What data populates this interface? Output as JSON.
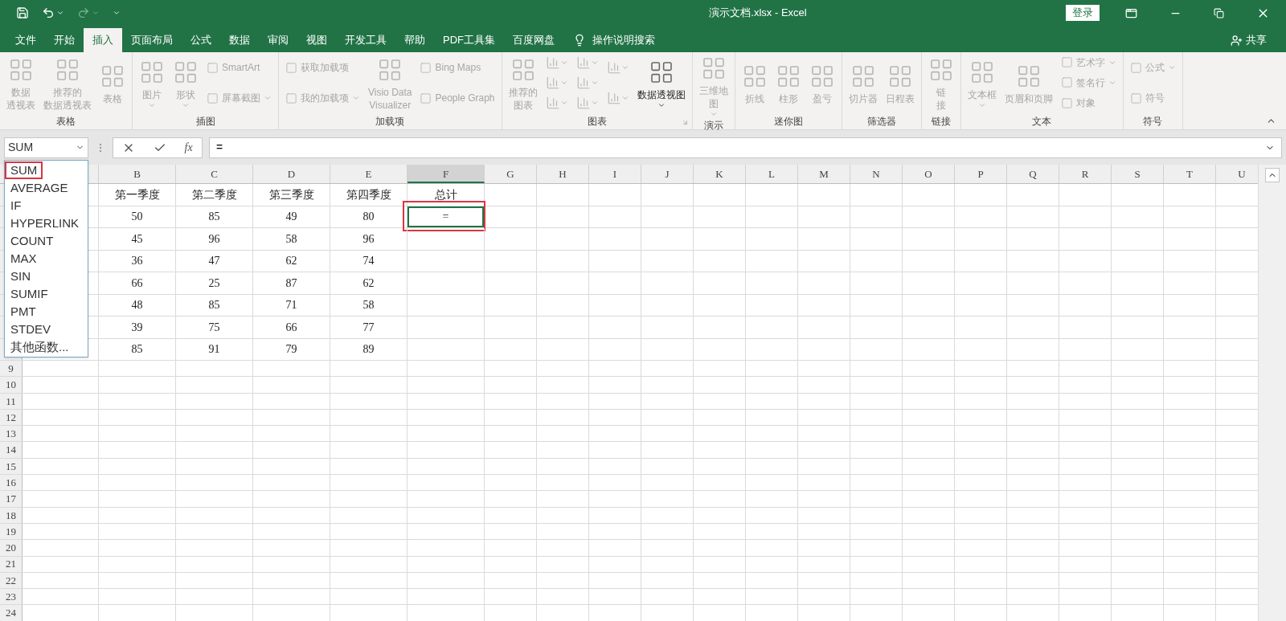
{
  "window": {
    "title": "演示文档.xlsx - Excel",
    "login": "登录"
  },
  "menu_tabs": [
    {
      "label": "文件",
      "selected": false
    },
    {
      "label": "开始",
      "selected": false
    },
    {
      "label": "插入",
      "selected": true
    },
    {
      "label": "页面布局",
      "selected": false
    },
    {
      "label": "公式",
      "selected": false
    },
    {
      "label": "数据",
      "selected": false
    },
    {
      "label": "审阅",
      "selected": false
    },
    {
      "label": "视图",
      "selected": false
    },
    {
      "label": "开发工具",
      "selected": false
    },
    {
      "label": "帮助",
      "selected": false
    },
    {
      "label": "PDF工具集",
      "selected": false
    },
    {
      "label": "百度网盘",
      "selected": false
    }
  ],
  "tell_me": "操作说明搜索",
  "share": "共享",
  "ribbon": [
    {
      "label": "表格",
      "columns": [
        [
          {
            "kind": "large",
            "lines": [
              "数据",
              "透视表"
            ],
            "disabled": true,
            "dropdown": false
          }
        ],
        [
          {
            "kind": "large",
            "lines": [
              "推荐的",
              "数据透视表"
            ],
            "disabled": true,
            "dropdown": false
          }
        ],
        [
          {
            "kind": "large",
            "lines": [
              "表格"
            ],
            "disabled": true,
            "dropdown": false
          }
        ]
      ]
    },
    {
      "label": "插图",
      "columns": [
        [
          {
            "kind": "large",
            "lines": [
              "图片"
            ],
            "disabled": true,
            "dropdown": true
          }
        ],
        [
          {
            "kind": "large",
            "lines": [
              "形状"
            ],
            "disabled": true,
            "dropdown": true
          }
        ],
        [
          {
            "kind": "small",
            "label": "SmartArt",
            "disabled": true,
            "dropdown": false
          },
          {
            "kind": "small",
            "label": "屏幕截图",
            "disabled": true,
            "dropdown": true
          }
        ]
      ]
    },
    {
      "label": "加载项",
      "columns": [
        [
          {
            "kind": "small",
            "label": "获取加载项",
            "disabled": true,
            "dropdown": false
          },
          {
            "kind": "small",
            "label": "我的加载项",
            "disabled": true,
            "dropdown": true
          }
        ],
        [
          {
            "kind": "large",
            "lines": [
              "Visio Data",
              "Visualizer"
            ],
            "disabled": true,
            "dropdown": false
          }
        ],
        [
          {
            "kind": "small",
            "label": "Bing Maps",
            "disabled": true,
            "dropdown": false
          },
          {
            "kind": "small",
            "label": "People Graph",
            "disabled": true,
            "dropdown": false
          }
        ]
      ]
    },
    {
      "label": "图表",
      "launcher": true,
      "columns": [
        [
          {
            "kind": "large",
            "lines": [
              "推荐的",
              "图表"
            ],
            "disabled": true,
            "dropdown": false
          }
        ],
        [
          {
            "kind": "icon",
            "disabled": true,
            "dropdown": true
          },
          {
            "kind": "icon",
            "disabled": true,
            "dropdown": true
          },
          {
            "kind": "icon",
            "disabled": true,
            "dropdown": true
          }
        ],
        [
          {
            "kind": "icon",
            "disabled": true,
            "dropdown": true
          },
          {
            "kind": "icon",
            "disabled": true,
            "dropdown": true
          },
          {
            "kind": "icon",
            "disabled": true,
            "dropdown": true
          }
        ],
        [
          {
            "kind": "icon",
            "disabled": true,
            "dropdown": true
          },
          {
            "kind": "icon",
            "disabled": true,
            "dropdown": true
          }
        ],
        [
          {
            "kind": "large",
            "lines": [
              "数据透视图"
            ],
            "disabled": false,
            "dropdown": true
          }
        ]
      ]
    },
    {
      "label": "演示",
      "columns": [
        [
          {
            "kind": "large",
            "lines": [
              "三维地",
              "图"
            ],
            "disabled": true,
            "dropdown": true
          }
        ]
      ]
    },
    {
      "label": "迷你图",
      "columns": [
        [
          {
            "kind": "large",
            "lines": [
              "折线"
            ],
            "disabled": true,
            "dropdown": false
          }
        ],
        [
          {
            "kind": "large",
            "lines": [
              "柱形"
            ],
            "disabled": true,
            "dropdown": false
          }
        ],
        [
          {
            "kind": "large",
            "lines": [
              "盈亏"
            ],
            "disabled": true,
            "dropdown": false
          }
        ]
      ]
    },
    {
      "label": "筛选器",
      "columns": [
        [
          {
            "kind": "large",
            "lines": [
              "切片器"
            ],
            "disabled": true,
            "dropdown": false
          }
        ],
        [
          {
            "kind": "large",
            "lines": [
              "日程表"
            ],
            "disabled": true,
            "dropdown": false
          }
        ]
      ]
    },
    {
      "label": "链接",
      "columns": [
        [
          {
            "kind": "large",
            "lines": [
              "链",
              "接"
            ],
            "disabled": true,
            "dropdown": false
          }
        ]
      ]
    },
    {
      "label": "文本",
      "columns": [
        [
          {
            "kind": "large",
            "lines": [
              "文本框"
            ],
            "disabled": true,
            "dropdown": true
          }
        ],
        [
          {
            "kind": "large",
            "lines": [
              "页眉和页脚"
            ],
            "disabled": true,
            "dropdown": false
          }
        ],
        [
          {
            "kind": "small",
            "label": "艺术字",
            "disabled": true,
            "dropdown": true
          },
          {
            "kind": "small",
            "label": "签名行",
            "disabled": true,
            "dropdown": true
          },
          {
            "kind": "small",
            "label": "对象",
            "disabled": true,
            "dropdown": false
          }
        ]
      ]
    },
    {
      "label": "符号",
      "columns": [
        [
          {
            "kind": "small",
            "label": "公式",
            "disabled": true,
            "dropdown": true
          },
          {
            "kind": "small",
            "label": "符号",
            "disabled": true,
            "dropdown": false
          }
        ]
      ]
    }
  ],
  "formula_bar": {
    "name_box": "SUM",
    "function_button": "fx",
    "formula": "="
  },
  "function_list": [
    {
      "label": "SUM",
      "highlighted": true
    },
    {
      "label": "AVERAGE",
      "highlighted": false
    },
    {
      "label": "IF",
      "highlighted": false
    },
    {
      "label": "HYPERLINK",
      "highlighted": false
    },
    {
      "label": "COUNT",
      "highlighted": false
    },
    {
      "label": "MAX",
      "highlighted": false
    },
    {
      "label": "SIN",
      "highlighted": false
    },
    {
      "label": "SUMIF",
      "highlighted": false
    },
    {
      "label": "PMT",
      "highlighted": false
    },
    {
      "label": "STDEV",
      "highlighted": false
    },
    {
      "label": "其他函数...",
      "highlighted": false
    }
  ],
  "columns": [
    {
      "label": "B",
      "selected": false
    },
    {
      "label": "C",
      "selected": false
    },
    {
      "label": "D",
      "selected": false
    },
    {
      "label": "E",
      "selected": false
    },
    {
      "label": "F",
      "selected": true
    },
    {
      "label": "G",
      "selected": false
    },
    {
      "label": "H",
      "selected": false
    },
    {
      "label": "I",
      "selected": false
    },
    {
      "label": "J",
      "selected": false
    },
    {
      "label": "K",
      "selected": false
    },
    {
      "label": "L",
      "selected": false
    },
    {
      "label": "M",
      "selected": false
    },
    {
      "label": "N",
      "selected": false
    },
    {
      "label": "O",
      "selected": false
    },
    {
      "label": "P",
      "selected": false
    },
    {
      "label": "Q",
      "selected": false
    },
    {
      "label": "R",
      "selected": false
    },
    {
      "label": "S",
      "selected": false
    },
    {
      "label": "T",
      "selected": false
    },
    {
      "label": "U",
      "selected": false
    }
  ],
  "rows": [
    {
      "cells": [
        {
          "text": "第一季度",
          "selected": false,
          "highlighted": false
        },
        {
          "text": "第二季度",
          "selected": false,
          "highlighted": false
        },
        {
          "text": "第三季度",
          "selected": false,
          "highlighted": false
        },
        {
          "text": "第四季度",
          "selected": false,
          "highlighted": false
        },
        {
          "text": "总计",
          "selected": false,
          "highlighted": false
        }
      ]
    },
    {
      "cells": [
        {
          "text": "50",
          "selected": false,
          "highlighted": false
        },
        {
          "text": "85",
          "selected": false,
          "highlighted": false
        },
        {
          "text": "49",
          "selected": false,
          "highlighted": false
        },
        {
          "text": "80",
          "selected": false,
          "highlighted": false
        },
        {
          "text": "=",
          "selected": true,
          "highlighted": true
        }
      ]
    },
    {
      "cells": [
        {
          "text": "45",
          "selected": false,
          "highlighted": false
        },
        {
          "text": "96",
          "selected": false,
          "highlighted": false
        },
        {
          "text": "58",
          "selected": false,
          "highlighted": false
        },
        {
          "text": "96",
          "selected": false,
          "highlighted": false
        }
      ]
    },
    {
      "cells": [
        {
          "text": "36",
          "selected": false,
          "highlighted": false
        },
        {
          "text": "47",
          "selected": false,
          "highlighted": false
        },
        {
          "text": "62",
          "selected": false,
          "highlighted": false
        },
        {
          "text": "74",
          "selected": false,
          "highlighted": false
        }
      ]
    },
    {
      "cells": [
        {
          "text": "66",
          "selected": false,
          "highlighted": false
        },
        {
          "text": "25",
          "selected": false,
          "highlighted": false
        },
        {
          "text": "87",
          "selected": false,
          "highlighted": false
        },
        {
          "text": "62",
          "selected": false,
          "highlighted": false
        }
      ]
    },
    {
      "cells": [
        {
          "text": "48",
          "selected": false,
          "highlighted": false
        },
        {
          "text": "85",
          "selected": false,
          "highlighted": false
        },
        {
          "text": "71",
          "selected": false,
          "highlighted": false
        },
        {
          "text": "58",
          "selected": false,
          "highlighted": false
        }
      ]
    },
    {
      "cells": [
        {
          "text": "39",
          "selected": false,
          "highlighted": false
        },
        {
          "text": "75",
          "selected": false,
          "highlighted": false
        },
        {
          "text": "66",
          "selected": false,
          "highlighted": false
        },
        {
          "text": "77",
          "selected": false,
          "highlighted": false
        }
      ]
    },
    {
      "cells": [
        {
          "text": "85",
          "selected": false,
          "highlighted": false
        },
        {
          "text": "91",
          "selected": false,
          "highlighted": false
        },
        {
          "text": "79",
          "selected": false,
          "highlighted": false
        },
        {
          "text": "89",
          "selected": false,
          "highlighted": false
        }
      ]
    },
    {
      "label": "9"
    },
    {
      "label": "10"
    },
    {
      "label": "11"
    },
    {
      "label": "12"
    },
    {
      "label": "13"
    },
    {
      "label": "14"
    },
    {
      "label": "15"
    },
    {
      "label": "16"
    },
    {
      "label": "17"
    },
    {
      "label": "18"
    },
    {
      "label": "19"
    },
    {
      "label": "20"
    },
    {
      "label": "21"
    },
    {
      "label": "22"
    },
    {
      "label": "23"
    },
    {
      "label": "24"
    }
  ]
}
